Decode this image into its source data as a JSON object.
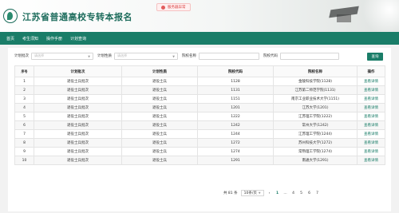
{
  "header": {
    "title": "江苏省普通高校专转本报名",
    "notice": "服务器异常"
  },
  "nav": [
    "首页",
    "考生须知",
    "操作手册",
    "计划查询"
  ],
  "filters": {
    "plan_batch_label": "计划批次",
    "plan_batch_placeholder": "请选择",
    "plan_nature_label": "计划性质",
    "plan_nature_placeholder": "请选择",
    "school_name_label": "院校名称",
    "school_code_label": "院校代码",
    "query_button": "查询"
  },
  "table": {
    "headers": [
      "序号",
      "计划批次",
      "计划性质",
      "院校代码",
      "院校名称",
      "操作"
    ],
    "rows": [
      [
        "1",
        "退役士兵批次",
        "退役士兵",
        "1128",
        "金陵科技学院(1128)",
        "查看详情"
      ],
      [
        "2",
        "退役士兵批次",
        "退役士兵",
        "1131",
        "江苏第二师范学院(1131)",
        "查看详情"
      ],
      [
        "3",
        "退役士兵批次",
        "退役士兵",
        "1151",
        "南京工业职业技术大学(1151)",
        "查看详情"
      ],
      [
        "4",
        "退役士兵批次",
        "退役士兵",
        "1201",
        "江苏大学(1201)",
        "查看详情"
      ],
      [
        "5",
        "退役士兵批次",
        "退役士兵",
        "1222",
        "江苏理工学院(1222)",
        "查看详情"
      ],
      [
        "6",
        "退役士兵批次",
        "退役士兵",
        "1242",
        "常州大学(1242)",
        "查看详情"
      ],
      [
        "7",
        "退役士兵批次",
        "退役士兵",
        "1244",
        "江苏理工学院(1244)",
        "查看详情"
      ],
      [
        "8",
        "退役士兵批次",
        "退役士兵",
        "1272",
        "苏州科技大学(1272)",
        "查看详情"
      ],
      [
        "9",
        "退役士兵批次",
        "退役士兵",
        "1274",
        "常熟理工学院(1274)",
        "查看详情"
      ],
      [
        "10",
        "退役士兵批次",
        "退役士兵",
        "1291",
        "南通大学(1291)",
        "查看详情"
      ]
    ]
  },
  "pager": {
    "total": "共 81 条",
    "page_size": "10条/页",
    "pages": [
      "‹",
      "1",
      "...",
      "4",
      "5",
      "6",
      "7"
    ]
  },
  "colors": {
    "brand": "#1a7d68",
    "title": "#1d6c5c",
    "notice": "#d94040"
  }
}
